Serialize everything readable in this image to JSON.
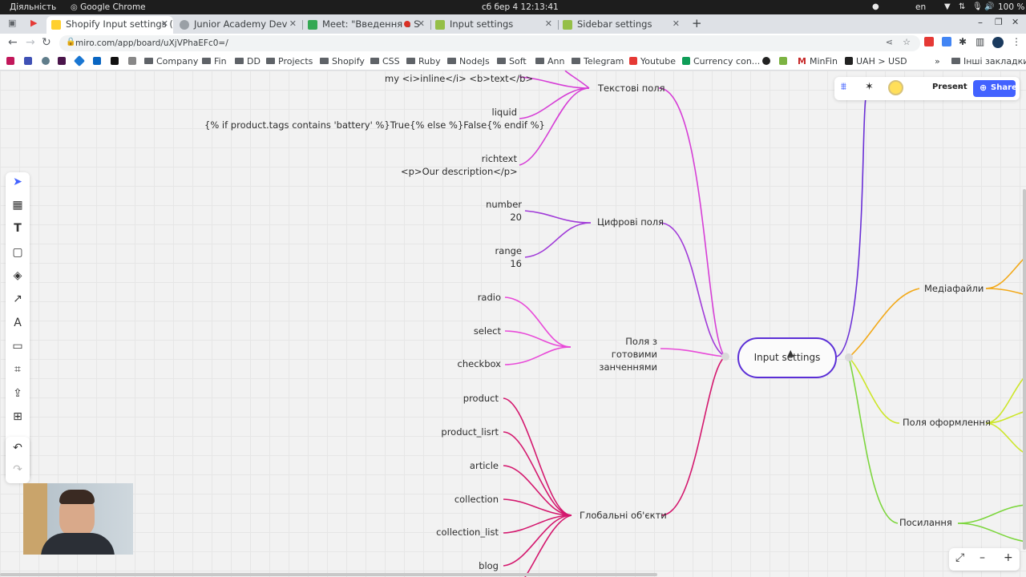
{
  "os_bar": {
    "activities": "Діяльність",
    "app": "Google Chrome",
    "clock": "сб бер 4  12:13:41",
    "lang": "en",
    "battery": "100 %"
  },
  "tabs": [
    {
      "label": "Shopify Input settings (",
      "color": "#ffcc00"
    },
    {
      "label": "Junior Academy Dev",
      "color": "#5f6368"
    },
    {
      "label": "Meet: \"Введення в S",
      "color": "#34a853"
    },
    {
      "label": "Input settings",
      "color": "#95bf47"
    },
    {
      "label": "Sidebar settings",
      "color": "#95bf47"
    }
  ],
  "url": "miro.com/app/board/uXjVPhaEFc0=/",
  "bookmarks": [
    {
      "label": "Company",
      "type": "folder"
    },
    {
      "label": "Fin",
      "type": "folder"
    },
    {
      "label": "DD",
      "type": "folder"
    },
    {
      "label": "Projects",
      "type": "folder"
    },
    {
      "label": "Shopify",
      "type": "folder"
    },
    {
      "label": "CSS",
      "type": "folder"
    },
    {
      "label": "Ruby",
      "type": "folder"
    },
    {
      "label": "NodeJs",
      "type": "folder"
    },
    {
      "label": "Soft",
      "type": "folder"
    },
    {
      "label": "Ann",
      "type": "folder"
    },
    {
      "label": "Telegram",
      "type": "folder"
    },
    {
      "label": "Youtube",
      "type": "site"
    },
    {
      "label": "Currency con...",
      "type": "site"
    },
    {
      "label": "MinFin",
      "type": "site"
    },
    {
      "label": "UAH > USD",
      "type": "site"
    },
    {
      "label": "Інші закладки",
      "type": "folder"
    }
  ],
  "mindmap": {
    "root": "Input settings",
    "branches": {
      "text_fields": "Текстові поля",
      "numeric_fields": "Цифрові поля",
      "preset_fields": "Поля з готовими занченнями",
      "global_objects": "Глобальні об'єкти",
      "media": "Медіафайли",
      "design_fields": "Поля оформлення",
      "links": "Посилання"
    },
    "text_children": [
      "my <i>inline</i> <b>text</b>",
      "liquid",
      "{% if product.tags contains 'battery' %}True{% else %}False{% endif %}",
      "richtext",
      "<p>Our description</p>"
    ],
    "numeric_children": [
      "number",
      "20",
      "range",
      "16"
    ],
    "preset_children": [
      "radio",
      "select",
      "checkbox"
    ],
    "global_children": [
      "product",
      "product_lisrt",
      "article",
      "collection",
      "collection_list",
      "blog"
    ]
  },
  "toolbar": {
    "present": "Present",
    "share": "Share"
  }
}
